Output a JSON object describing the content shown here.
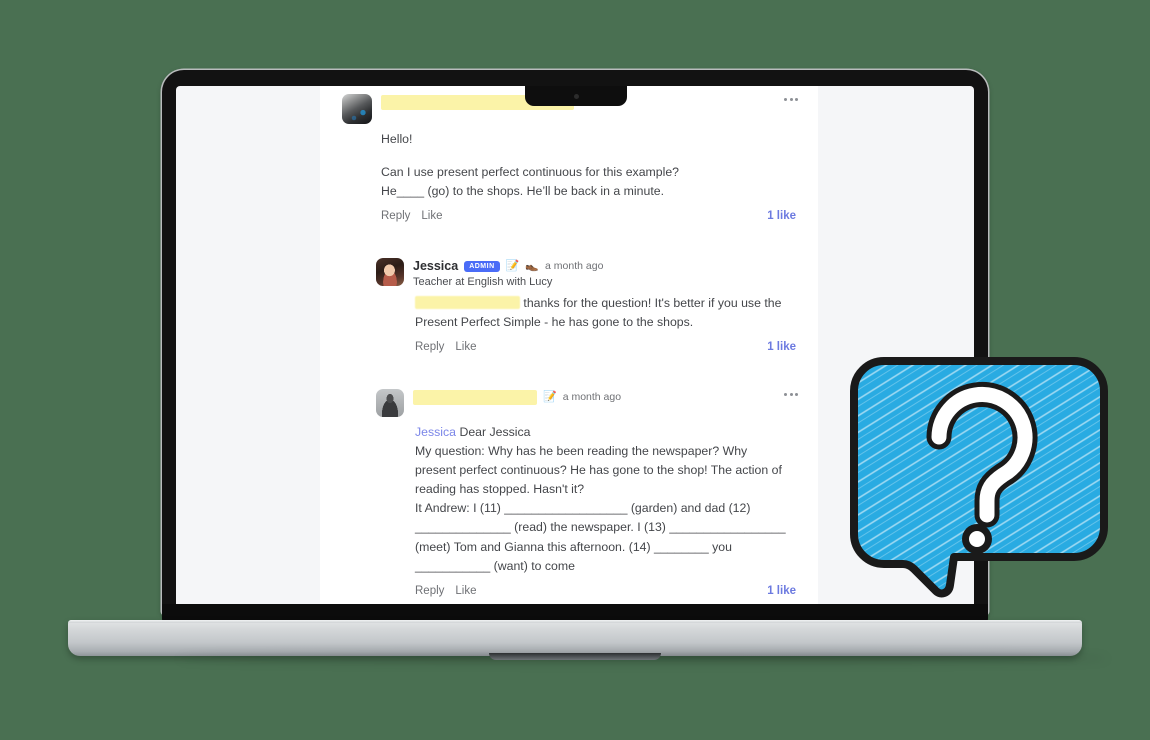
{
  "background": {
    "color": "#4a7052"
  },
  "device": {
    "name": "laptop-mockup",
    "type": "laptop",
    "bezel_color": "#121212",
    "base_color": "#c3c7ca"
  },
  "page": {
    "column_background": "#ffffff",
    "app_background": "#f5f6f8"
  },
  "comments": [
    {
      "id": "comment-1",
      "author_name_redacted": true,
      "avatar": "avatar-grayscale-city",
      "menu_icon": "kebab-menu-icon",
      "body_lines": [
        "Hello!",
        "Can I use present perfect continuous for this example?",
        "He____ (go) to the shops. He’ll be back in a minute."
      ],
      "actions": {
        "reply": "Reply",
        "like": "Like"
      },
      "like_count": "1 like"
    },
    {
      "id": "comment-2",
      "author_name": "Jessica",
      "badge": "ADMIN",
      "badge_color": "#4a6cf7",
      "emoji_1": "📝",
      "emoji_2": "👞",
      "timestamp": "a month ago",
      "subtitle": "Teacher at English with Lucy",
      "avatar": "avatar-jessica-portrait",
      "body_prefix_redacted": true,
      "body_lines": [
        "thanks for the question! It's better if you use the",
        "Present Perfect Simple - he has gone to the shops."
      ],
      "actions": {
        "reply": "Reply",
        "like": "Like"
      },
      "like_count": "1 like"
    },
    {
      "id": "comment-3",
      "author_name_redacted": true,
      "emoji_1": "📝",
      "timestamp": "a month ago",
      "avatar": "avatar-dark-figure",
      "menu_icon": "kebab-menu-icon",
      "mention": "Jessica",
      "body_lines": [
        "Dear Jessica",
        "My question:  Why has he been reading the newspaper? Why",
        "present perfect continuous? He has gone to the shop! The action of",
        "reading has stopped. Hasn't it?",
        "It Andrew: I (11) __________________ (garden) and dad (12)",
        "______________ (read) the newspaper. I (13) _________________",
        "(meet) Tom and Gianna this afternoon. (14) ________ you",
        "___________ (want) to come"
      ],
      "actions": {
        "reply": "Reply",
        "like": "Like"
      },
      "like_count": "1 like"
    }
  ],
  "graphic": {
    "name": "question-speech-bubble",
    "fill_color": "#29abe2",
    "stroke_color": "#1a1a1a",
    "mark_color": "#ffffff",
    "symbol": "?"
  }
}
